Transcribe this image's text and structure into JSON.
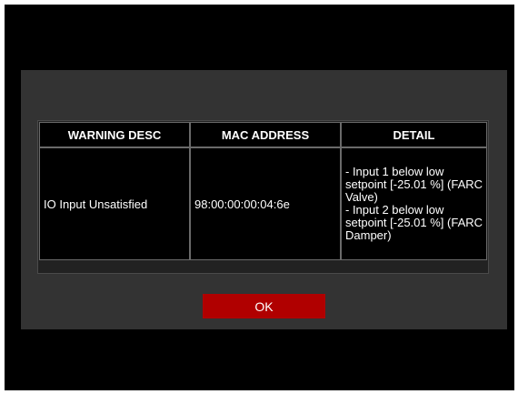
{
  "table": {
    "headers": [
      "WARNING DESC",
      "MAC ADDRESS",
      "DETAIL"
    ],
    "rows": [
      {
        "warning_desc": "IO Input Unsatisfied",
        "mac_address": "98:00:00:00:04:6e",
        "detail": "- Input 1 below low\nsetpoint [-25.01 %] (FARC\nValve)\n- Input 2 below low\nsetpoint [-25.01 %] (FARC\nDamper)"
      }
    ]
  },
  "ok_label": "OK",
  "colors": {
    "screen_bg": "#000000",
    "dialog_bg": "#333333",
    "ok_button": "#b00000"
  }
}
